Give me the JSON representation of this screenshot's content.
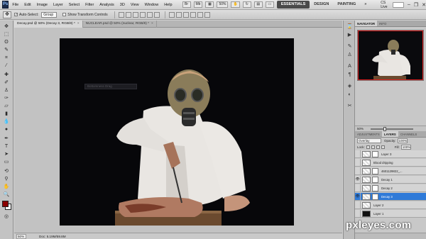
{
  "app": {
    "logo": "Ps"
  },
  "menu": [
    "File",
    "Edit",
    "Image",
    "Layer",
    "Select",
    "Filter",
    "Analysis",
    "3D",
    "View",
    "Window",
    "Help"
  ],
  "menubar_tools": {
    "zoom": "50%"
  },
  "workspaces": {
    "essentials": "ESSENTIALS",
    "design": "DESIGN",
    "painting": "PAINTING",
    "more": "»",
    "cs_live": "CS Live"
  },
  "options": {
    "auto_select_label": "Auto-Select:",
    "auto_select_value": "Group",
    "show_transform_label": "Show Transform Controls"
  },
  "tabs": [
    {
      "label": "Decay.psd @ 50% (Decay 3, RGB/8) *",
      "close": "×"
    },
    {
      "label": "NUCLEAR.psd @ 50% (nuclear, RGB/8) *",
      "close": "×"
    }
  ],
  "canvas": {
    "tooltip": "Bottomness Drag"
  },
  "status": {
    "zoom": "50%",
    "doc": "Doc: 5.19M/59.8M"
  },
  "navigator": {
    "tabs": [
      "NAVIGATOR",
      "INFO"
    ],
    "zoom": "50%"
  },
  "layers_panel": {
    "tabs": [
      "ADJUSTMENTS",
      "LAYERS",
      "CHANNELS"
    ],
    "blend_mode": "Overlay",
    "opacity_label": "Opacity:",
    "opacity": "100%",
    "lock_label": "Lock:",
    "fill_label": "Fill:",
    "fill": "100%",
    "layers": [
      {
        "name": "Layer 3",
        "visible": false,
        "selected": false,
        "dark": false,
        "mask": true
      },
      {
        "name": "Blood dripping",
        "visible": false,
        "selected": false,
        "dark": false,
        "mask": false
      },
      {
        "name": "4601129822_...",
        "visible": false,
        "selected": false,
        "dark": false,
        "mask": true
      },
      {
        "name": "Decay 1",
        "visible": true,
        "selected": false,
        "dark": false,
        "mask": true
      },
      {
        "name": "Decay 2",
        "visible": false,
        "selected": false,
        "dark": false,
        "mask": true
      },
      {
        "name": "Decay 3",
        "visible": true,
        "selected": true,
        "dark": false,
        "mask": true
      },
      {
        "name": "Layer 2",
        "visible": false,
        "selected": false,
        "dark": false,
        "mask": false
      },
      {
        "name": "Layer 1",
        "visible": false,
        "selected": false,
        "dark": true,
        "mask": false
      }
    ]
  },
  "watermark": "pxleyes.com",
  "colors": {
    "foreground": "#8b0000",
    "background": "#ffffff",
    "selection": "#2f7ad8",
    "nav_box": "#e02020"
  }
}
